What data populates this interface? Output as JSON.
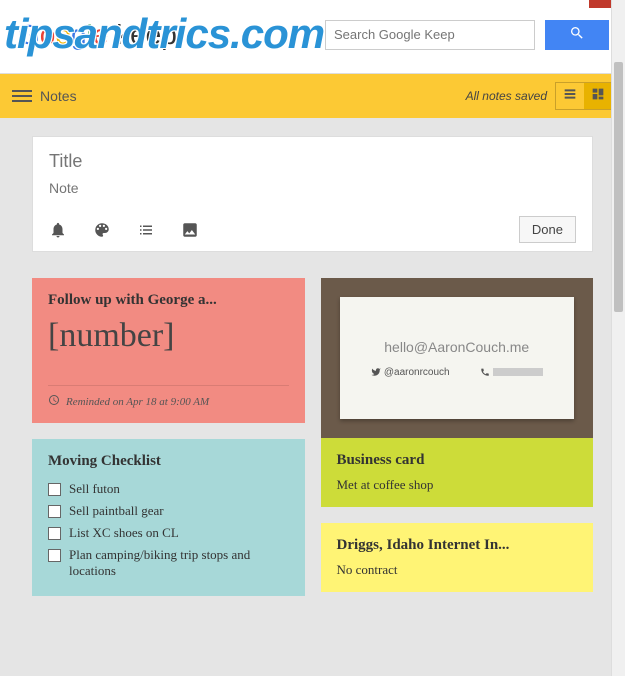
{
  "watermark": "tipsandtrics.com",
  "header": {
    "logo_prefix": "Google",
    "logo_suffix": "keep",
    "search_placeholder": "Search Google Keep"
  },
  "toolbar": {
    "title": "Notes",
    "status": "All notes saved"
  },
  "compose": {
    "title_placeholder": "Title",
    "body_placeholder": "Note",
    "done_label": "Done"
  },
  "notes": {
    "followup": {
      "title": "Follow up with George a...",
      "number": "[number]",
      "reminder": "Reminded on Apr 18 at 9:00 AM"
    },
    "moving": {
      "title": "Moving Checklist",
      "items": [
        "Sell futon",
        "Sell paintball gear",
        "List XC shoes on CL",
        "Plan camping/biking trip stops and locations"
      ]
    },
    "business": {
      "card_email": "hello@AaronCouch.me",
      "card_twitter": "@aaronrcouch",
      "title": "Business card",
      "body": "Met at coffee shop"
    },
    "driggs": {
      "title": "Driggs, Idaho Internet In...",
      "body": "No contract"
    }
  }
}
